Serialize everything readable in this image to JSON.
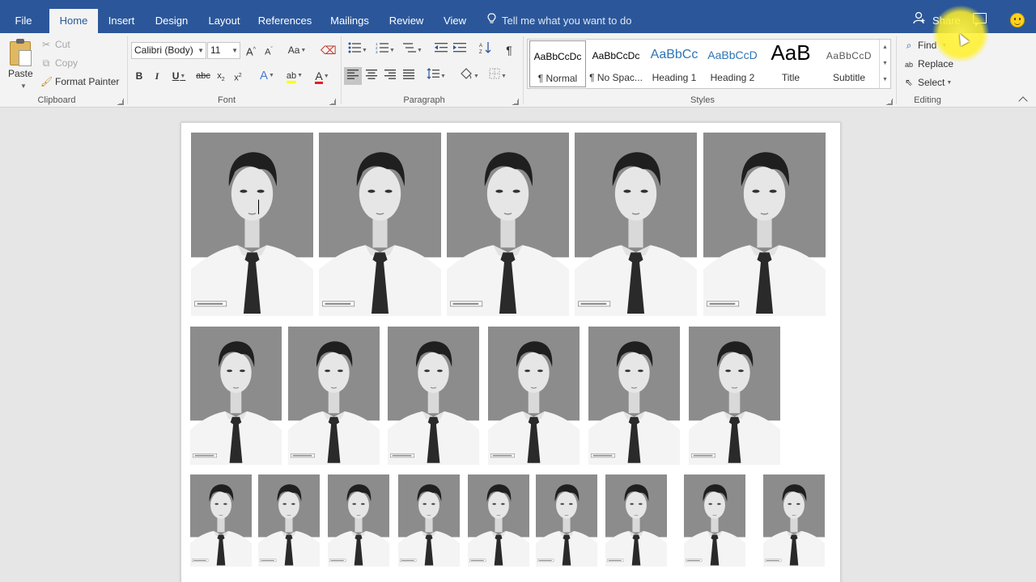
{
  "tabs": [
    {
      "label": "File",
      "active": false
    },
    {
      "label": "Home",
      "active": true
    },
    {
      "label": "Insert",
      "active": false
    },
    {
      "label": "Design",
      "active": false
    },
    {
      "label": "Layout",
      "active": false
    },
    {
      "label": "References",
      "active": false
    },
    {
      "label": "Mailings",
      "active": false
    },
    {
      "label": "Review",
      "active": false
    },
    {
      "label": "View",
      "active": false
    }
  ],
  "tell_me": "Tell me what you want to do",
  "share": "Share",
  "clipboard": {
    "paste": "Paste",
    "cut": "Cut",
    "copy": "Copy",
    "format_painter": "Format Painter",
    "group_label": "Clipboard"
  },
  "font": {
    "name": "Calibri (Body)",
    "size": "11",
    "group_label": "Font"
  },
  "paragraph": {
    "group_label": "Paragraph"
  },
  "styles": {
    "group_label": "Styles",
    "items": [
      {
        "preview": "AaBbCcDc",
        "name": "¶ Normal",
        "selected": true
      },
      {
        "preview": "AaBbCcDc",
        "name": "¶ No Spac...",
        "selected": false
      },
      {
        "preview": "AaBbCc",
        "name": "Heading 1",
        "selected": false
      },
      {
        "preview": "AaBbCcD",
        "name": "Heading 2",
        "selected": false
      },
      {
        "preview": "AaB",
        "name": "Title",
        "selected": false
      },
      {
        "preview": "AaBbCcD",
        "name": "Subtitle",
        "selected": false
      }
    ]
  },
  "editing": {
    "find": "Find",
    "replace": "Replace",
    "select": "Select",
    "group_label": "Editing"
  },
  "colors": {
    "title_bar": "#2b579a",
    "ribbon": "#f3f3f3",
    "photo_background": "#8c8c8c"
  },
  "document": {
    "photo_rows": [
      {
        "count": 5,
        "size": "large"
      },
      {
        "count": 6,
        "size": "medium"
      },
      {
        "count": 9,
        "size": "small"
      }
    ]
  }
}
